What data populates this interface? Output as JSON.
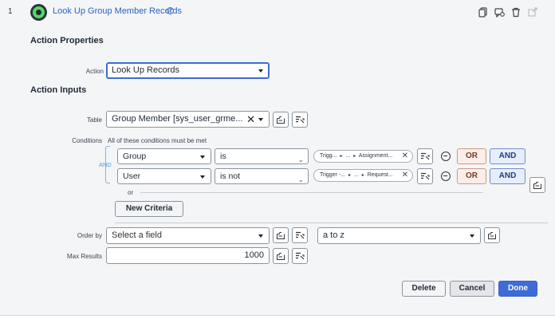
{
  "header": {
    "row_number": "1",
    "title": "Look Up Group Member Records",
    "help_glyph": "?",
    "colors": {
      "link": "#2962c7",
      "logo_green": "#54d96a"
    },
    "icons": [
      "copy-icon",
      "comment-icon",
      "trash-icon",
      "open-external-icon"
    ]
  },
  "action_properties": {
    "heading": "Action Properties",
    "action_label": "Action",
    "action_value": "Look Up Records"
  },
  "action_inputs": {
    "heading": "Action Inputs",
    "table_label": "Table",
    "table_value": "Group Member [sys_user_grme...",
    "conditions_label": "Conditions",
    "conditions_note": "All of these conditions must be met",
    "and_label": "AND",
    "conditions": [
      {
        "field": "Group",
        "operator": "is",
        "pill": {
          "part1": "Trigg...",
          "part2": "...",
          "part3": "Assignment..."
        },
        "or_label": "OR",
        "and_label": "AND"
      },
      {
        "field": "User",
        "operator": "is not",
        "pill": {
          "part1": "Trigger -...",
          "part2": "...",
          "part3": "Request..."
        },
        "or_label": "OR",
        "and_label": "AND"
      }
    ],
    "or_label": "or",
    "new_criteria_label": "New Criteria",
    "order_by_label": "Order by",
    "order_by_placeholder": "Select a field",
    "order_direction": "a to z",
    "max_results_label": "Max Results",
    "max_results_value": "1000"
  },
  "footer": {
    "delete_label": "Delete",
    "cancel_label": "Cancel",
    "done_label": "Done",
    "colors": {
      "done_bg": "#3f6ad8"
    }
  }
}
